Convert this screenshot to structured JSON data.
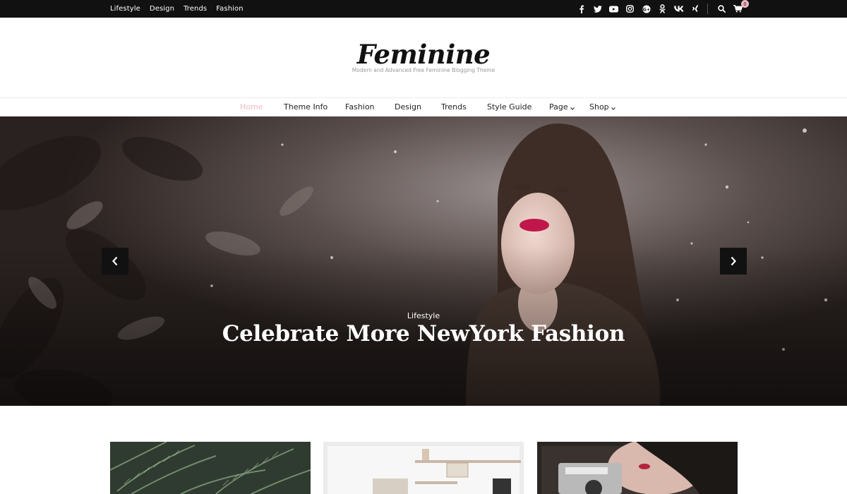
{
  "topbar": {
    "links": [
      "Lifestyle",
      "Design",
      "Trends",
      "Fashion"
    ],
    "social_icons": [
      "facebook-icon",
      "twitter-icon",
      "youtube-icon",
      "instagram-icon",
      "google-plus-icon",
      "odnoklassniki-icon",
      "vk-icon",
      "xing-icon"
    ],
    "cart_count": "0"
  },
  "header": {
    "logo": "Feminine",
    "tagline": "Modern and Advanced Free Feminine Blogging Theme"
  },
  "nav": {
    "items": [
      "Home",
      "Theme Info",
      "Fashion",
      "Design",
      "Trends",
      "Style Guide",
      "Page",
      "Shop"
    ],
    "active": "Home"
  },
  "hero": {
    "category": "Lifestyle",
    "title": "Celebrate More NewYork Fashion"
  },
  "colors": {
    "topbar_bg": "#111111",
    "accent_pink": "#f4b8c4",
    "text_dark": "#222222"
  }
}
